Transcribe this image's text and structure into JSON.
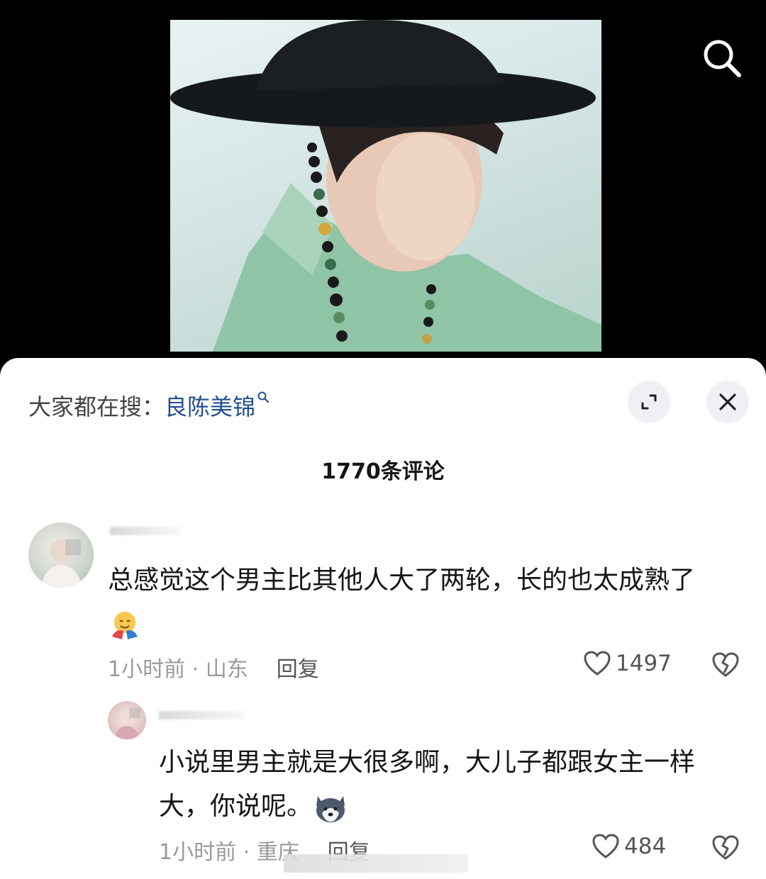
{
  "hot_search": {
    "prefix": "大家都在搜：",
    "keyword": "良陈美锦"
  },
  "comment_count": "1770条评论",
  "comments": [
    {
      "text": "总感觉这个男主比其他人大了两轮，长的也太成熟了",
      "time_location": "1小时前 · 山东",
      "reply_label": "回复",
      "likes": "1497"
    },
    {
      "text": "小说里男主就是大很多啊，大儿子都跟女主一样大，你说呢。",
      "time_location": "1小时前 · 重庆",
      "reply_label": "回复",
      "likes": "484"
    }
  ],
  "icons": {
    "search": "search-icon",
    "expand": "expand-icon",
    "close": "close-icon",
    "like": "heart-icon",
    "dislike": "broken-heart-icon"
  }
}
